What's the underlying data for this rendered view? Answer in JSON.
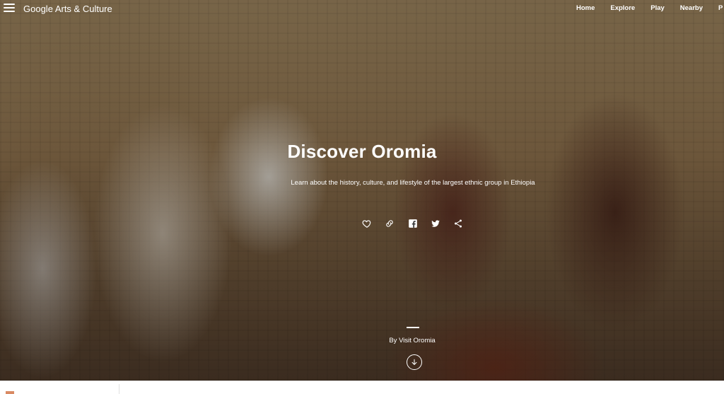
{
  "header": {
    "menu_icon": "hamburger-menu-icon",
    "logo": "Google Arts & Culture",
    "nav": [
      "Home",
      "Explore",
      "Play",
      "Nearby",
      "P"
    ]
  },
  "hero": {
    "title": "Discover Oromia",
    "subtitle": "Learn about the history, culture, and lifestyle of the largest ethnic group in Ethiopia",
    "actions": [
      "heart-icon",
      "link-icon",
      "facebook-icon",
      "twitter-icon",
      "share-icon"
    ],
    "attribution": "By Visit Oromia",
    "scroll_icon": "arrow-down-icon"
  },
  "colors": {
    "text": "#ffffff",
    "thumb_accent": "#d98a63"
  }
}
